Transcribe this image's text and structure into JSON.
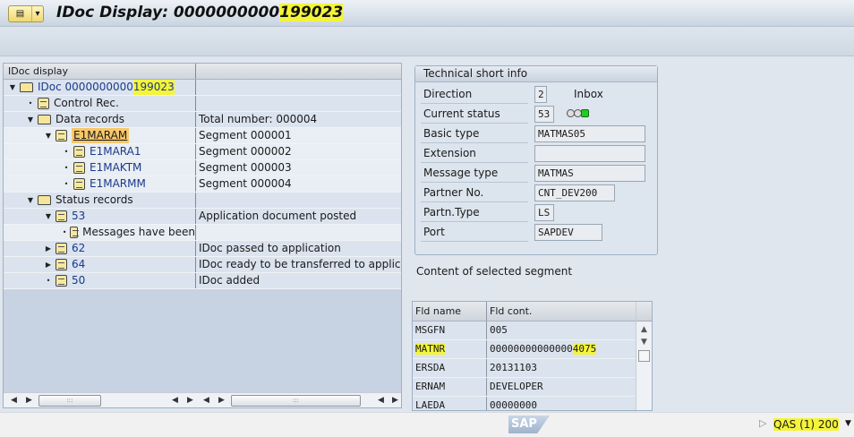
{
  "window": {
    "title_prefix": "IDoc Display: 0000000000",
    "title_highlight": "199023",
    "menu_icon": "menu-icon",
    "menu_dropdown": "chevron-down-icon"
  },
  "tree": {
    "header": "IDoc display",
    "rows": [
      {
        "label": "IDoc 0000000000",
        "hl": "199023",
        "desc": "",
        "toggle": "expanded",
        "icon": "folder"
      },
      {
        "label": "Control Rec.",
        "desc": "",
        "toggle": "leaf",
        "icon": "document"
      },
      {
        "label": "Data records",
        "desc": "Total number: 000004",
        "toggle": "expanded",
        "icon": "folder"
      },
      {
        "label": "E1MARAM",
        "desc": "Segment 000001",
        "toggle": "expanded",
        "icon": "document",
        "selected": true
      },
      {
        "label": "E1MARA1",
        "desc": "Segment 000002",
        "toggle": "leaf",
        "icon": "document"
      },
      {
        "label": "E1MAKTM",
        "desc": "Segment 000003",
        "toggle": "leaf",
        "icon": "document"
      },
      {
        "label": "E1MARMM",
        "desc": "Segment 000004",
        "toggle": "leaf",
        "icon": "document"
      },
      {
        "label": "Status records",
        "desc": "",
        "toggle": "expanded",
        "icon": "folder"
      },
      {
        "label": "53",
        "desc": "Application document posted",
        "toggle": "expanded",
        "icon": "document"
      },
      {
        "label": "Messages have been",
        "desc": "",
        "toggle": "leaf",
        "icon": "document"
      },
      {
        "label": "62",
        "desc": "IDoc passed to application",
        "toggle": "collapsed",
        "icon": "document"
      },
      {
        "label": "64",
        "desc": "IDoc ready to be transferred to application",
        "toggle": "collapsed",
        "icon": "document"
      },
      {
        "label": "50",
        "desc": "IDoc added",
        "toggle": "leaf",
        "icon": "document"
      }
    ]
  },
  "info": {
    "title": "Technical short info",
    "fields": [
      {
        "label": "Direction",
        "value": "2",
        "extra": "Inbox"
      },
      {
        "label": "Current status",
        "value": "53",
        "status_light": "green"
      },
      {
        "label": "Basic type",
        "value": "MATMAS05"
      },
      {
        "label": "Extension",
        "value": ""
      },
      {
        "label": "Message type",
        "value": "MATMAS"
      },
      {
        "label": "Partner No.",
        "value": "CNT_DEV200"
      },
      {
        "label": "Partn.Type",
        "value": "LS"
      },
      {
        "label": "Port",
        "value": "SAPDEV"
      }
    ]
  },
  "segment": {
    "title": "Content of selected segment",
    "columns": [
      "Fld name",
      "Fld cont."
    ],
    "rows": [
      {
        "name": "MSGFN",
        "value": "005"
      },
      {
        "name": "MATNR",
        "value": "00000000000000",
        "hl": "4075"
      },
      {
        "name": "ERSDA",
        "value": "20131103"
      },
      {
        "name": "ERNAM",
        "value": "DEVELOPER"
      },
      {
        "name": "LAEDA",
        "value": "00000000"
      }
    ]
  },
  "statusbar": {
    "logo": "SAP",
    "system": "QAS (1) 200"
  },
  "colors": {
    "highlight": "#f4f43a",
    "selection": "#f7c86a",
    "status_green": "#22cc22"
  }
}
